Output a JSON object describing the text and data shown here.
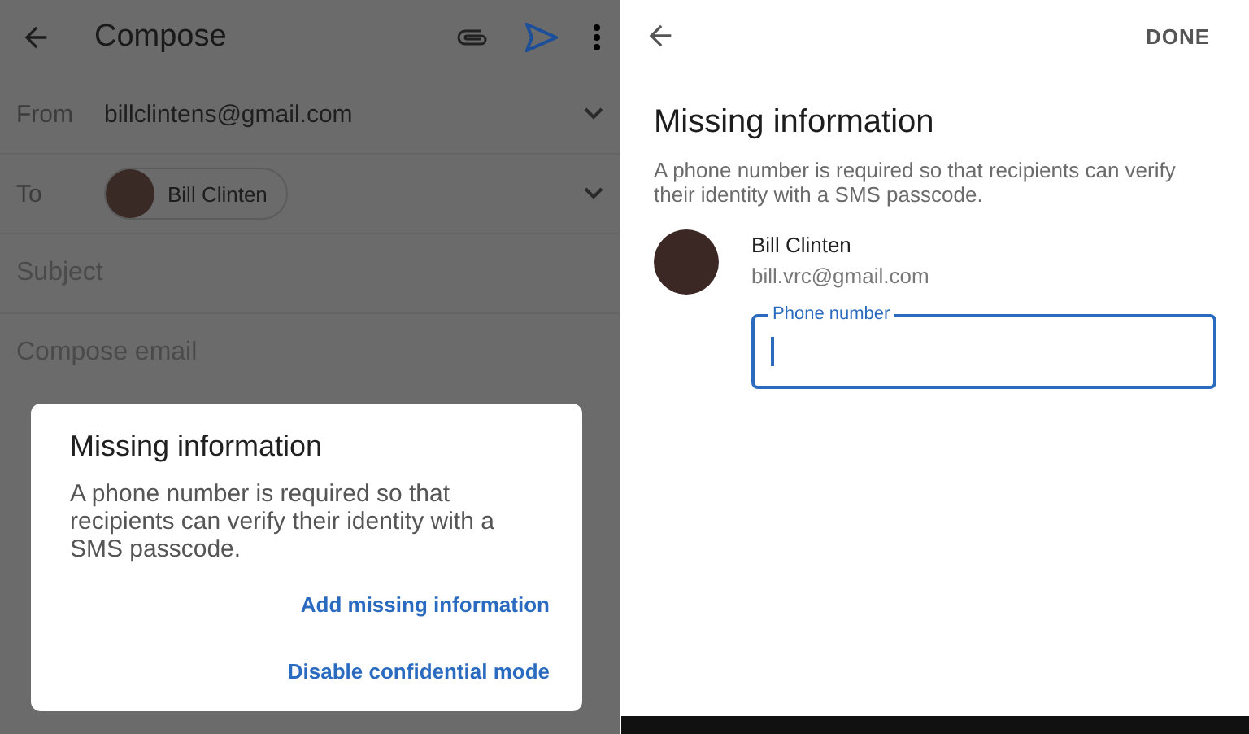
{
  "compose": {
    "title": "Compose",
    "from": {
      "label": "From",
      "value": "billclintens@gmail.com"
    },
    "to": {
      "label": "To",
      "recipients": [
        "Bill Clinten"
      ]
    },
    "subject": {
      "placeholder": "Subject"
    },
    "body": {
      "placeholder": "Compose email"
    }
  },
  "dialog": {
    "title": "Missing information",
    "message": "A phone number is required so that recipients can verify their identity with a SMS passcode.",
    "actions": [
      "Add missing information",
      "Disable confidential mode"
    ]
  },
  "missing_info": {
    "done": "DONE",
    "title": "Missing information",
    "message": "A phone number is required so that recipients can verify their identity with a SMS passcode.",
    "contact": {
      "name": "Bill Clinten",
      "email": "bill.vrc@gmail.com"
    },
    "phone_field": {
      "label": "Phone number"
    }
  }
}
